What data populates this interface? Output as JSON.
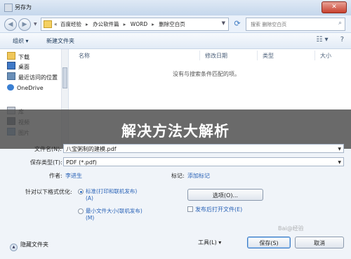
{
  "window": {
    "title": "另存为"
  },
  "address": {
    "crumbs": [
      "百度经验",
      "办公软件篇",
      "WORD",
      "删除空白页"
    ],
    "crumb_prefix": "«",
    "search_placeholder": "搜索 删除空白页"
  },
  "toolbar": {
    "organize": "组织 ▾",
    "new_folder": "新建文件夹"
  },
  "nav": {
    "items": [
      {
        "label": "下载",
        "icon": "download-folder-icon"
      },
      {
        "label": "桌面",
        "icon": "desktop-icon"
      },
      {
        "label": "最近访问的位置",
        "icon": "recent-places-icon"
      },
      {
        "label": "OneDrive",
        "icon": "onedrive-icon"
      },
      {
        "label": "库",
        "icon": "library-icon"
      },
      {
        "label": "视频",
        "icon": "video-icon"
      },
      {
        "label": "图片",
        "icon": "pictures-icon"
      }
    ]
  },
  "filelist": {
    "columns": [
      "名称",
      "修改日期",
      "类型",
      "大小"
    ],
    "empty_message": "没有与搜索条件匹配的项。"
  },
  "banner": {
    "text": "解决方法大解析"
  },
  "form": {
    "filename_label": "文件名(N):",
    "filename_value": "八宝粥制的建模.pdf",
    "savetype_label": "保存类型(T):",
    "savetype_value": "PDF (*.pdf)",
    "author_label": "作者:",
    "author_value": "李进生",
    "tags_label": "标记:",
    "tags_value": "添加标记",
    "optimize_label": "针对以下格式优化:",
    "option_standard": "标准(打印和联机发布)\n(A)",
    "option_min": "最小文件大小(联机发布)\n(M)",
    "options_button": "选项(O)...",
    "open_after_label": "发布后打开文件(E)",
    "hide_folders": "隐藏文件夹",
    "tools": "工具(L)",
    "save": "保存(S)",
    "cancel": "取消"
  },
  "watermark": "Bai@经验"
}
